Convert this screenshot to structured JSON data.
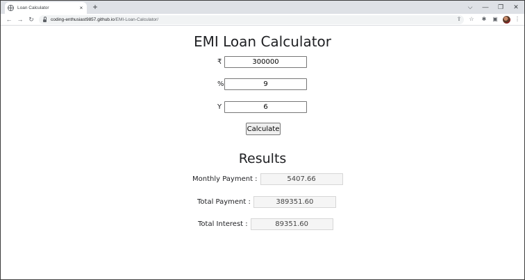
{
  "browser": {
    "tab_title": "Loan Calculator",
    "tab_close": "×",
    "new_tab": "+",
    "url_host": "coding-enthusiast9857.github.io",
    "url_path": "/EMI-Loan-Calculator/",
    "icons": [
      "globe-icon",
      "back-icon",
      "forward-icon",
      "reload-icon",
      "lock-icon",
      "share-icon",
      "star-icon",
      "extensions-icon",
      "sidepanel-icon",
      "profile-avatar",
      "menu-icon"
    ],
    "controls": {
      "tab_search": "⌵",
      "minimize": "—",
      "restore": "❐",
      "close": "✕",
      "back": "←",
      "forward": "→",
      "reload": "↻",
      "share": "⇪",
      "star": "☆",
      "extensions": "✱",
      "sidepanel": "▣",
      "menu": "⋮"
    }
  },
  "page": {
    "title": "EMI Loan Calculator",
    "inputs": [
      {
        "symbol": "₹",
        "value": "300000"
      },
      {
        "symbol": "%",
        "value": "9"
      },
      {
        "symbol": "Y",
        "value": "6"
      }
    ],
    "calculate_label": "Calculate",
    "results_title": "Results",
    "results": [
      {
        "label": "Monthly Payment :",
        "value": "5407.66"
      },
      {
        "label": "Total Payment :",
        "value": "389351.60"
      },
      {
        "label": "Total Interest :",
        "value": "89351.60"
      }
    ]
  },
  "colors": {
    "tabstrip": "#dee1e6",
    "omnibox": "#f1f3f4",
    "result_field": "#f5f5f5"
  }
}
